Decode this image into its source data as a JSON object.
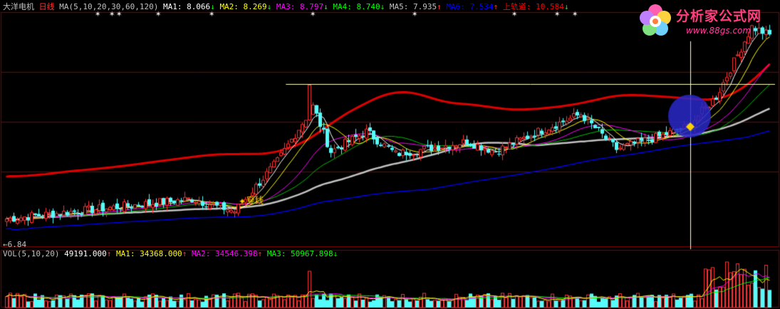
{
  "main_header": {
    "stock_name": "大洋电机",
    "period": "日线",
    "ma_label": "MA(5,10,20,30,60,120)",
    "items": [
      {
        "label": "MA1",
        "value": "8.066",
        "arrow": "↓",
        "color": "#ffffff"
      },
      {
        "label": "MA2",
        "value": "8.269",
        "arrow": "↓",
        "color": "#ffff00"
      },
      {
        "label": "MA3",
        "value": "8.797",
        "arrow": "↓",
        "color": "#ff00ff"
      },
      {
        "label": "MA4",
        "value": "8.740",
        "arrow": "↓",
        "color": "#00ff00"
      },
      {
        "label": "MA5",
        "value": "7.935",
        "arrow": "↑",
        "color": "#c0c0c0"
      },
      {
        "label": "MA6",
        "value": "7.534",
        "arrow": "↑",
        "color": "#0000ff"
      },
      {
        "label": "上轨道",
        "value": "10.584",
        "arrow": "↓",
        "color": "#ff0000"
      }
    ]
  },
  "vol_header": {
    "label": "VOL(5,10,20)",
    "value": "49191.000",
    "arrow": "↑",
    "items": [
      {
        "label": "MA1",
        "value": "34368.000",
        "arrow": "↑",
        "color": "#ffff00"
      },
      {
        "label": "MA2",
        "value": "34546.398",
        "arrow": "↑",
        "color": "#ff00ff"
      },
      {
        "label": "MA3",
        "value": "50967.898",
        "arrow": "↓",
        "color": "#00ff00"
      }
    ]
  },
  "annotation_text": "穿线",
  "low_label": "←6.84",
  "logo": {
    "title": "分析家公式网",
    "url": "www.88gs.com"
  },
  "colors": {
    "up": "#ff3232",
    "down": "#54fcfc",
    "grid": "#800000",
    "upper_track": "#e00000",
    "ma_slow": "#c0c0c0",
    "ma_long": "#0000ff"
  },
  "chart_data": {
    "type": "candlestick",
    "title": "大洋电机 日线",
    "price_range": [
      6.5,
      11.2
    ],
    "low_marker": 6.84,
    "horizontal_line_price": 9.75,
    "trend": [
      {
        "from": 7.05,
        "to": 7.45,
        "bars": 52
      },
      {
        "from": 7.45,
        "to": 7.2,
        "bars": 12
      },
      {
        "from": 7.2,
        "to": 8.2,
        "bars": 12
      },
      {
        "from": 8.2,
        "to": 9.3,
        "bars": 10
      },
      {
        "from": 9.3,
        "to": 8.4,
        "bars": 5
      },
      {
        "from": 8.4,
        "to": 8.8,
        "bars": 10
      },
      {
        "from": 8.8,
        "to": 8.35,
        "bars": 8
      },
      {
        "from": 8.35,
        "to": 8.6,
        "bars": 20
      },
      {
        "from": 8.6,
        "to": 8.4,
        "bars": 8
      },
      {
        "from": 8.4,
        "to": 8.8,
        "bars": 12
      },
      {
        "from": 8.8,
        "to": 9.15,
        "bars": 12
      },
      {
        "from": 9.15,
        "to": 8.45,
        "bars": 10
      },
      {
        "from": 8.45,
        "to": 8.7,
        "bars": 12
      },
      {
        "from": 8.7,
        "to": 8.9,
        "bars": 8
      },
      {
        "from": 8.9,
        "to": 9.5,
        "bars": 8
      },
      {
        "from": 9.5,
        "to": 10.9,
        "bars": 10
      },
      {
        "from": 10.9,
        "to": 10.7,
        "bars": 6
      }
    ]
  }
}
